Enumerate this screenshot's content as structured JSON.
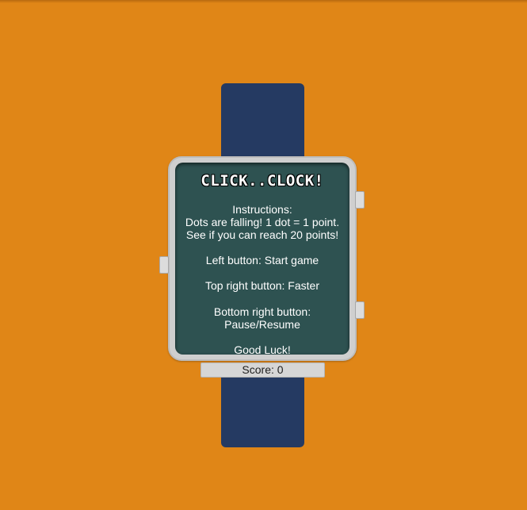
{
  "game": {
    "title": "CLICK..CLOCK!",
    "instructions": {
      "heading": "Instructions:",
      "line1": "Dots are falling! 1 dot = 1 point.",
      "line2": "See if you can reach 20 points!",
      "left_button": "Left button: Start game",
      "top_right_button": "Top right button: Faster",
      "bottom_right_button_line1": "Bottom right button:",
      "bottom_right_button_line2": "Pause/Resume",
      "closing": "Good Luck!"
    },
    "score": {
      "label": "Score:",
      "value": 0,
      "text": "Score: 0"
    }
  },
  "colors": {
    "background": "#e08617",
    "strap": "#253a62",
    "case": "#cfcfcf",
    "screen": "#2e5251",
    "text": "#ffffff"
  }
}
